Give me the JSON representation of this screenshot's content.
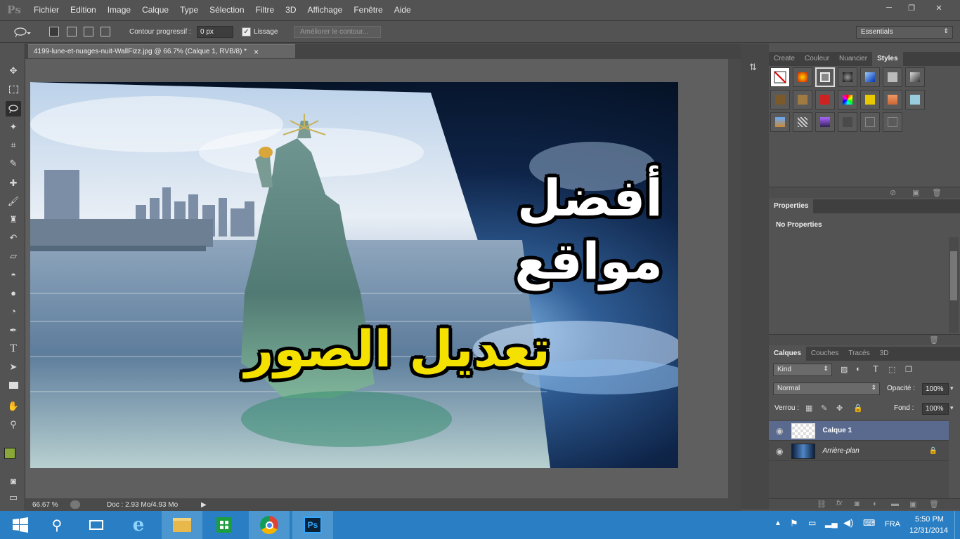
{
  "app": {
    "logo": "Ps"
  },
  "menu": [
    "Fichier",
    "Edition",
    "Image",
    "Calque",
    "Type",
    "Sélection",
    "Filtre",
    "3D",
    "Affichage",
    "Fenêtre",
    "Aide"
  ],
  "window_controls": {
    "minimize": "─",
    "restore": "❐",
    "close": "✕"
  },
  "options": {
    "feather_label": "Contour progressif :",
    "feather_value": "0 px",
    "antialias_label": "Lissage",
    "antialias_checked": true,
    "refine_label": "Améliorer le contour...",
    "workspace": "Essentials"
  },
  "document": {
    "tab_title": "4199-lune-et-nuages-nuit-WallFizz.jpg @ 66.7% (Calque 1, RVB/8) *",
    "close": "×",
    "zoom": "66.67 %",
    "doc_size": "Doc : 2.93 Mo/4.93 Mo",
    "text_line1": "أفضل مواقع",
    "text_line2": "تعديل الصور"
  },
  "colors": {
    "foreground": "#8aa83a",
    "background": "#ffffff",
    "accent_text": "#f5e100"
  },
  "styles_panel": {
    "tabs": [
      "Create",
      "Couleur",
      "Nuancier",
      "Styles"
    ],
    "active_tab": "Styles"
  },
  "properties_panel": {
    "tab": "Properties",
    "empty_text": "No Properties"
  },
  "layers_panel": {
    "tabs": [
      "Calques",
      "Couches",
      "Tracés",
      "3D"
    ],
    "active_tab": "Calques",
    "kind_label": "Kind",
    "blend_mode": "Normal",
    "opacity_label": "Opacité :",
    "opacity": "100%",
    "lock_label": "Verrou :",
    "fill_label": "Fond :",
    "fill": "100%",
    "layers": [
      {
        "name": "Calque 1",
        "selected": true,
        "visible": true
      },
      {
        "name": "Arrière-plan",
        "selected": false,
        "visible": true,
        "locked": true
      }
    ]
  },
  "taskbar": {
    "apps": [
      "start-icon",
      "search-icon",
      "task-view-icon",
      "ie-icon",
      "explorer-icon",
      "store-icon",
      "chrome-icon",
      "photoshop-icon"
    ],
    "language": "FRA",
    "time": "5:50 PM",
    "date": "12/31/2014",
    "ps_label": "Ps"
  }
}
